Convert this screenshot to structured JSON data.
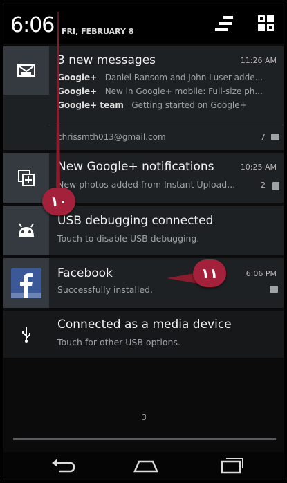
{
  "status": {
    "time": "6:06",
    "date": "FRI, FEBRUARY 8"
  },
  "header_icons": {
    "settings": "quick-settings-icon",
    "tiles": "notification-tiles-icon"
  },
  "notifications": {
    "gmail": {
      "title": "3 new messages",
      "time": "11:26 AM",
      "lines": [
        {
          "sender": "Google+",
          "text": "Daniel Ransom and John Luser adde..."
        },
        {
          "sender": "Google+",
          "text": "New in Google+ mobile: Full-size ph..."
        },
        {
          "sender": "Google+ team",
          "text": "Getting started on Google+"
        }
      ],
      "account": "chrissmth013@gmail.com",
      "count": "7"
    },
    "gplus": {
      "title": "New Google+ notifications",
      "time": "10:25 AM",
      "subtitle": "New photos added from Instant Upload...",
      "count": "2"
    },
    "usb_debug": {
      "title": "USB debugging connected",
      "subtitle": "Touch to disable USB debugging."
    },
    "facebook": {
      "title": "Facebook",
      "subtitle": "Successfully installed.",
      "time": "6:06 PM"
    },
    "media": {
      "title": "Connected as a media device",
      "subtitle": "Touch for other USB options."
    }
  },
  "callouts": {
    "first": "١٠",
    "second": "١١"
  },
  "page_indicator": "3",
  "navbar": {
    "back": "back-icon",
    "home": "home-icon",
    "recents": "recents-icon"
  },
  "colors": {
    "callout": "#a3213a",
    "icon_box": "#343a40",
    "facebook": "#3b5998"
  }
}
